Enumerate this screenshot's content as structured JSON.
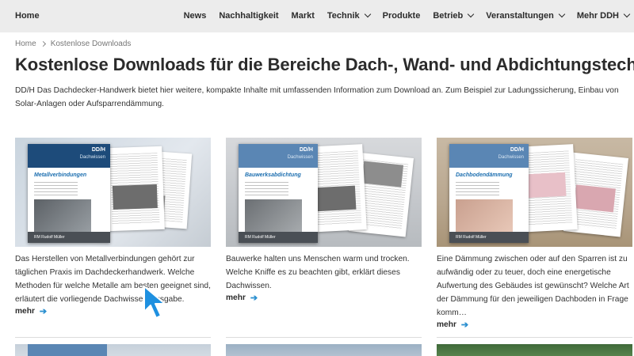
{
  "header": {
    "brand": "Home",
    "nav": [
      "News",
      "Nachhaltigkeit",
      "Markt",
      "Technik",
      "Produkte",
      "Betrieb",
      "Veranstaltungen",
      "Mehr DDH"
    ],
    "nav_dropdown": [
      false,
      false,
      false,
      true,
      false,
      true,
      true,
      true
    ]
  },
  "breadcrumb": {
    "home": "Home",
    "current": "Kostenlose Downloads"
  },
  "page": {
    "title": "Kostenlose Downloads für die Bereiche Dach-, Wand- und Abdichtungstechnik",
    "intro": "DD/H Das Dachdecker-Handwerk bietet hier weitere, kompakte Inhalte mit umfassenden Information zum Download an. Zum Beispiel zur Ladungssicherung, Einbau von Solar-Anlagen oder Aufsparrendämmung."
  },
  "cards": [
    {
      "cover_logo": "DD/H",
      "cover_series": "Dachwissen",
      "cover_title": "Metallverbindungen",
      "cover_footer": "RM Rudolf Müller",
      "text": "Das Herstellen von Metallverbindungen gehört zur täglichen Praxis im Dachdeckerhandwerk. Welche Methoden für welche Metalle am besten geeignet sind, erläutert die vorliegende Dachwissen-Ausgabe.",
      "more": "mehr",
      "arrow": "➔"
    },
    {
      "cover_logo": "DD/H",
      "cover_series": "Dachwissen",
      "cover_title": "Bauwerksabdichtung",
      "cover_footer": "RM Rudolf Müller",
      "text": "Bauwerke halten uns Menschen warm und trocken. Welche Kniffe es zu beachten gibt, erklärt dieses Dachwissen.",
      "more": "mehr",
      "arrow": "➔"
    },
    {
      "cover_logo": "DD/H",
      "cover_series": "Dachwissen",
      "cover_title": "Dachbodendämmung",
      "cover_footer": "RM Rudolf Müller",
      "text": "Eine Dämmung zwischen oder auf den Sparren ist zu aufwändig oder zu teuer, doch eine energetische Aufwertung des Gebäudes ist gewünscht? Welche Art der Dämmung für den jeweiligen Dachboden in Frage komm…",
      "more": "mehr",
      "arrow": "➔"
    }
  ],
  "colors": {
    "accent": "#2a8fd0",
    "cover_blue": "#1d4b7a",
    "cursor": "#1e90e0"
  }
}
